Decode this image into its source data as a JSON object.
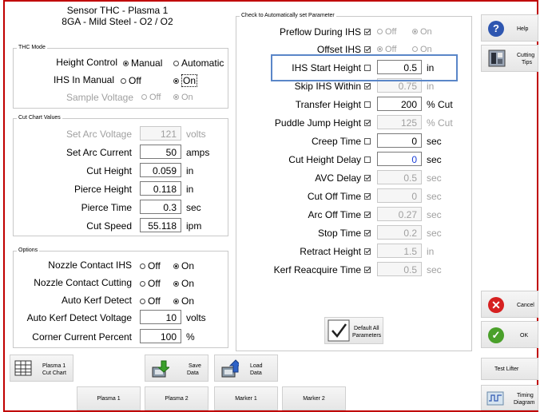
{
  "header": {
    "line1": "Sensor THC - Plasma 1",
    "line2": "8GA - Mild Steel - O2 / O2"
  },
  "thc_mode": {
    "title": "THC Mode",
    "height_control": {
      "label": "Height Control",
      "opt1": "Manual",
      "opt2": "Automatic",
      "selected": "Manual"
    },
    "ihs_in_manual": {
      "label": "IHS In Manual",
      "opt1": "Off",
      "opt2": "On",
      "selected": "On"
    },
    "sample_voltage": {
      "label": "Sample Voltage",
      "opt1": "Off",
      "opt2": "On",
      "selected": "On"
    }
  },
  "cut_chart": {
    "title": "Cut Chart Values",
    "set_arc_voltage": {
      "label": "Set Arc Voltage",
      "value": "121",
      "unit": "volts"
    },
    "set_arc_current": {
      "label": "Set Arc Current",
      "value": "50",
      "unit": "amps"
    },
    "cut_height": {
      "label": "Cut Height",
      "value": "0.059",
      "unit": "in"
    },
    "pierce_height": {
      "label": "Pierce Height",
      "value": "0.118",
      "unit": "in"
    },
    "pierce_time": {
      "label": "Pierce Time",
      "value": "0.3",
      "unit": "sec"
    },
    "cut_speed": {
      "label": "Cut Speed",
      "value": "55.118",
      "unit": "ipm"
    }
  },
  "options": {
    "title": "Options",
    "nozzle_contact_ihs": {
      "label": "Nozzle Contact IHS",
      "opt1": "Off",
      "opt2": "On",
      "selected": "On"
    },
    "nozzle_contact_cutting": {
      "label": "Nozzle Contact Cutting",
      "opt1": "Off",
      "opt2": "On",
      "selected": "On"
    },
    "auto_kerf_detect": {
      "label": "Auto Kerf Detect",
      "opt1": "Off",
      "opt2": "On",
      "selected": "On"
    },
    "auto_kerf_detect_voltage": {
      "label": "Auto Kerf Detect Voltage",
      "value": "10",
      "unit": "volts"
    },
    "corner_current_percent": {
      "label": "Corner Current Percent",
      "value": "100",
      "unit": "%"
    }
  },
  "auto_params": {
    "title": "Check to Automatically set Parameter",
    "preflow_during_ihs": {
      "label": "Preflow During IHS",
      "checked": true,
      "opt1": "Off",
      "opt2": "On",
      "selected": "On"
    },
    "offset_ihs": {
      "label": "Offset IHS",
      "checked": true,
      "opt1": "Off",
      "opt2": "On",
      "selected": "Off"
    },
    "rows": [
      {
        "label": "IHS Start Height",
        "checked": false,
        "value": "0.5",
        "unit": "in"
      },
      {
        "label": "Skip IHS Within",
        "checked": true,
        "value": "0.75",
        "unit": "in"
      },
      {
        "label": "Transfer Height",
        "checked": false,
        "value": "200",
        "unit": "% Cut"
      },
      {
        "label": "Puddle Jump Height",
        "checked": true,
        "value": "125",
        "unit": "% Cut"
      },
      {
        "label": "Creep Time",
        "checked": false,
        "value": "0",
        "unit": "sec"
      },
      {
        "label": "Cut Height Delay",
        "checked": false,
        "value": "0",
        "unit": "sec"
      },
      {
        "label": "AVC Delay",
        "checked": true,
        "value": "0.5",
        "unit": "sec"
      },
      {
        "label": "Cut Off Time",
        "checked": true,
        "value": "0",
        "unit": "sec"
      },
      {
        "label": "Arc Off Time",
        "checked": true,
        "value": "0.27",
        "unit": "sec"
      },
      {
        "label": "Stop Time",
        "checked": true,
        "value": "0.2",
        "unit": "sec"
      },
      {
        "label": "Retract Height",
        "checked": true,
        "value": "1.5",
        "unit": "in"
      },
      {
        "label": "Kerf Reacquire Time",
        "checked": true,
        "value": "0.5",
        "unit": "sec"
      }
    ],
    "default_all": {
      "line1": "Default All",
      "line2": "Parameters"
    }
  },
  "right_buttons": {
    "help": "Help",
    "cutting_tips": {
      "line1": "Cutting",
      "line2": "Tips"
    },
    "cancel": "Cancel",
    "ok": "OK",
    "test_lifter": "Test Lifter",
    "timing_diagram": {
      "line1": "Timing",
      "line2": "Diagram"
    }
  },
  "bottom": {
    "plasma_cut_chart": {
      "line1": "Plasma 1",
      "line2": "Cut Chart"
    },
    "save_data": {
      "line1": "Save",
      "line2": "Data"
    },
    "load_data": {
      "line1": "Load",
      "line2": "Data"
    },
    "tabs": [
      "Plasma 1",
      "Plasma 2",
      "Marker 1",
      "Marker 2"
    ]
  },
  "colors": {
    "frame": "#c00000",
    "focus": "#5a86c8",
    "help": "#2e56b0",
    "cancel": "#d62020",
    "ok": "#4aa02a"
  }
}
